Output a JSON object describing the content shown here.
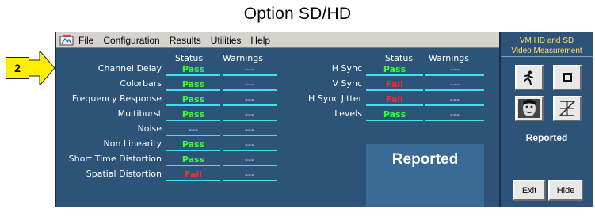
{
  "caption": "Option SD/HD",
  "step_number": "2",
  "menu": [
    "File",
    "Configuration",
    "Results",
    "Utilities",
    "Help"
  ],
  "columns": {
    "status": "Status",
    "warnings": "Warnings"
  },
  "left_tests": [
    {
      "label": "Channel Delay",
      "status": "Pass",
      "warning": "---"
    },
    {
      "label": "Colorbars",
      "status": "Pass",
      "warning": "---"
    },
    {
      "label": "Frequency Response",
      "status": "Pass",
      "warning": "---"
    },
    {
      "label": "Multiburst",
      "status": "Pass",
      "warning": "---"
    },
    {
      "label": "Noise",
      "status": "---",
      "warning": "---"
    },
    {
      "label": "Non Linearity",
      "status": "Pass",
      "warning": "---"
    },
    {
      "label": "Short Time Distortion",
      "status": "Pass",
      "warning": "---"
    },
    {
      "label": "Spatial Distortion",
      "status": "Fail",
      "warning": "---"
    }
  ],
  "right_tests": [
    {
      "label": "H Sync",
      "status": "Pass",
      "warning": "---"
    },
    {
      "label": "V Sync",
      "status": "Fail",
      "warning": "---"
    },
    {
      "label": "H Sync Jitter",
      "status": "Fail",
      "warning": "---"
    },
    {
      "label": "Levels",
      "status": "Pass",
      "warning": "---"
    }
  ],
  "reported_label": "Reported",
  "panel": {
    "title_line1": "VM HD and SD",
    "title_line2": "Video Measurement",
    "status": "Reported",
    "exit_label": "Exit",
    "hide_label": "Hide"
  },
  "colors": {
    "window_bg": "#2e5379",
    "pass": "#38ff38",
    "fail": "#ff2a2a",
    "cell_underline": "#3ce0f0",
    "callout": "#ffee00"
  },
  "icons": [
    "run-icon",
    "stop-icon",
    "face-display-icon",
    "waveform-display-icon",
    "arrow-callout-icon"
  ]
}
